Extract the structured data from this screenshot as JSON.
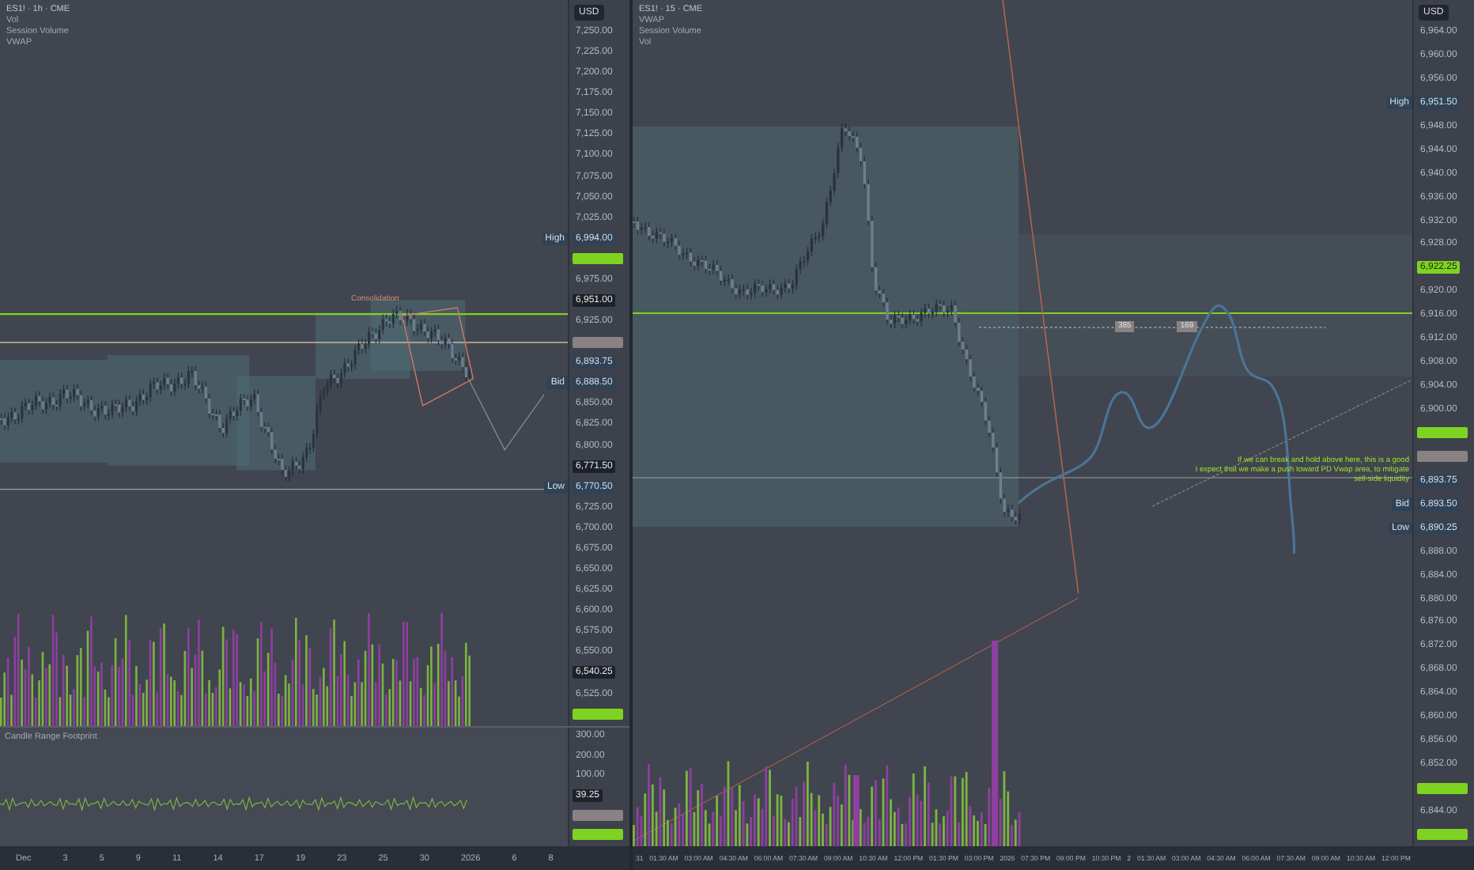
{
  "left_panel": {
    "header": [
      "ES1! · 1h · CME",
      "Vol",
      "Session Volume",
      "VWAP"
    ],
    "chart_label": "Consolidation",
    "price_axis": {
      "currency": "USD",
      "items": [
        {
          "kind": "tick",
          "text": "7,250.00"
        },
        {
          "kind": "tick",
          "text": "7,225.00"
        },
        {
          "kind": "tick",
          "text": "7,200.00"
        },
        {
          "kind": "tick",
          "text": "7,175.00"
        },
        {
          "kind": "tick",
          "text": "7,150.00"
        },
        {
          "kind": "tick",
          "text": "7,125.00"
        },
        {
          "kind": "tick",
          "text": "7,100.00"
        },
        {
          "kind": "tick",
          "text": "7,075.00"
        },
        {
          "kind": "tick",
          "text": "7,050.00"
        },
        {
          "kind": "tick",
          "text": "7,025.00"
        },
        {
          "kind": "blue-badge",
          "text": "6,994.00",
          "tag": "High"
        },
        {
          "kind": "green-marker"
        },
        {
          "kind": "tick",
          "text": "6,975.00"
        },
        {
          "kind": "dark-badge",
          "text": "6,951.00"
        },
        {
          "kind": "tick",
          "text": "6,925.00"
        },
        {
          "kind": "gray-marker"
        },
        {
          "kind": "blue-badge",
          "text": "6,893.75"
        },
        {
          "kind": "blue-badge",
          "text": "6,888.50",
          "tag": "Bid"
        },
        {
          "kind": "tick",
          "text": "6,850.00"
        },
        {
          "kind": "tick",
          "text": "6,825.00"
        },
        {
          "kind": "tick",
          "text": "6,800.00"
        },
        {
          "kind": "dark-badge",
          "text": "6,771.50"
        },
        {
          "kind": "blue-badge",
          "text": "6,770.50",
          "tag": "Low"
        },
        {
          "kind": "tick",
          "text": "6,725.00"
        },
        {
          "kind": "tick",
          "text": "6,700.00"
        },
        {
          "kind": "tick",
          "text": "6,675.00"
        },
        {
          "kind": "tick",
          "text": "6,650.00"
        },
        {
          "kind": "tick",
          "text": "6,625.00"
        },
        {
          "kind": "tick",
          "text": "6,600.00"
        },
        {
          "kind": "tick",
          "text": "6,575.00"
        },
        {
          "kind": "tick",
          "text": "6,550.00"
        },
        {
          "kind": "dark-badge",
          "text": "6,540.25"
        },
        {
          "kind": "tick",
          "text": "6,525.00"
        },
        {
          "kind": "green-marker"
        }
      ]
    },
    "lower_pane": {
      "title": "Candle Range Footprint",
      "axis_items": [
        {
          "kind": "tick",
          "text": "300.00"
        },
        {
          "kind": "tick",
          "text": "200.00"
        },
        {
          "kind": "tick",
          "text": "100.00"
        },
        {
          "kind": "dark-badge",
          "text": "39.25"
        },
        {
          "kind": "gray-marker"
        },
        {
          "kind": "green-marker"
        }
      ]
    },
    "time_axis": [
      "Dec",
      "3",
      "5",
      "9",
      "11",
      "14",
      "17",
      "19",
      "23",
      "25",
      "30",
      "2026",
      "6",
      "8"
    ]
  },
  "right_panel": {
    "header": [
      "ES1! · 15 · CME",
      "VWAP",
      "Session Volume",
      "Vol"
    ],
    "line_labels": [
      "385",
      "169"
    ],
    "annotation": [
      "If we can break and hold above here, this is a good",
      "I expect that we make a push toward PD Vwap area, to mitigate",
      "sell-side liquidity"
    ],
    "price_axis": {
      "currency": "USD",
      "items": [
        {
          "kind": "tick",
          "text": "6,964.00"
        },
        {
          "kind": "tick",
          "text": "6,960.00"
        },
        {
          "kind": "tick",
          "text": "6,956.00"
        },
        {
          "kind": "blue-badge",
          "text": "6,951.50",
          "tag": "High"
        },
        {
          "kind": "tick",
          "text": "6,948.00"
        },
        {
          "kind": "tick",
          "text": "6,944.00"
        },
        {
          "kind": "tick",
          "text": "6,940.00"
        },
        {
          "kind": "tick",
          "text": "6,936.00"
        },
        {
          "kind": "tick",
          "text": "6,932.00"
        },
        {
          "kind": "tick",
          "text": "6,928.00"
        },
        {
          "kind": "green-badge",
          "text": "6,922.25"
        },
        {
          "kind": "tick",
          "text": "6,920.00"
        },
        {
          "kind": "tick",
          "text": "6,916.00"
        },
        {
          "kind": "tick",
          "text": "6,912.00"
        },
        {
          "kind": "tick",
          "text": "6,908.00"
        },
        {
          "kind": "tick",
          "text": "6,904.00"
        },
        {
          "kind": "tick",
          "text": "6,900.00"
        },
        {
          "kind": "green-marker"
        },
        {
          "kind": "gray-marker"
        },
        {
          "kind": "blue-badge",
          "text": "6,893.75"
        },
        {
          "kind": "blue-badge",
          "text": "6,893.50",
          "tag": "Bid"
        },
        {
          "kind": "blue-badge",
          "text": "6,890.25",
          "tag": "Low"
        },
        {
          "kind": "tick",
          "text": "6,888.00"
        },
        {
          "kind": "tick",
          "text": "6,884.00"
        },
        {
          "kind": "tick",
          "text": "6,880.00"
        },
        {
          "kind": "tick",
          "text": "6,876.00"
        },
        {
          "kind": "tick",
          "text": "6,872.00"
        },
        {
          "kind": "tick",
          "text": "6,868.00"
        },
        {
          "kind": "tick",
          "text": "6,864.00"
        },
        {
          "kind": "tick",
          "text": "6,860.00"
        },
        {
          "kind": "tick",
          "text": "6,856.00"
        },
        {
          "kind": "tick",
          "text": "6,852.00"
        },
        {
          "kind": "green-marker"
        },
        {
          "kind": "tick",
          "text": "6,844.00"
        },
        {
          "kind": "green-marker"
        }
      ]
    },
    "time_axis": [
      "31",
      "01:30 AM",
      "03:00 AM",
      "04:30 AM",
      "06:00 AM",
      "07:30 AM",
      "09:00 AM",
      "10:30 AM",
      "12:00 PM",
      "01:30 PM",
      "03:00 PM",
      "2026",
      "07:30 PM",
      "09:00 PM",
      "10:30 PM",
      "2",
      "01:30 AM",
      "03:00 AM",
      "04:30 AM",
      "06:00 AM",
      "07:30 AM",
      "09:00 AM",
      "10:30 AM",
      "12:00 PM"
    ]
  }
}
